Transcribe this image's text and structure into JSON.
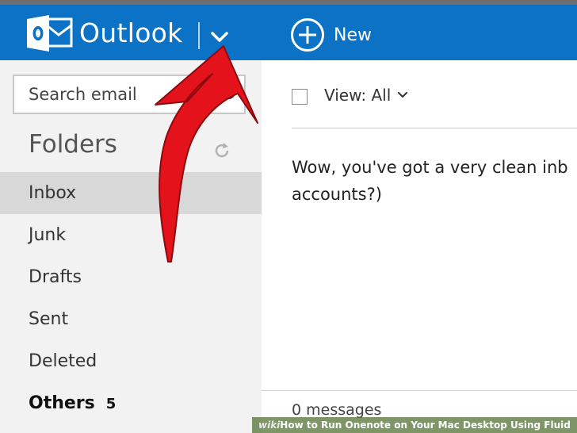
{
  "header": {
    "app_title": "Outlook",
    "new_label": "New",
    "brand_color": "#0b72c6",
    "logo_icon": "outlook-logo-icon",
    "switcher_icon": "chevron-down-icon",
    "new_icon": "plus-circle-icon"
  },
  "sidebar": {
    "search_placeholder": "Search email",
    "search_icon": "search-icon",
    "folders_heading": "Folders",
    "refresh_icon": "refresh-icon",
    "items": [
      {
        "label": "Inbox",
        "selected": true
      },
      {
        "label": "Junk"
      },
      {
        "label": "Drafts"
      },
      {
        "label": "Sent"
      },
      {
        "label": "Deleted"
      },
      {
        "label": "Others",
        "count": "5",
        "bold": true
      }
    ]
  },
  "content": {
    "view_label": "View: All",
    "empty_message": "Wow, you've got a very clean inb\naccounts?)",
    "message_count": "0 messages"
  },
  "annotation": {
    "arrow_color": "#e3121b",
    "icon": "red-arrow-annotation"
  },
  "watermark": {
    "brand": "wiki",
    "how": "How",
    "title": " to Run Onenote on Your Mac Desktop Using Fluid"
  }
}
